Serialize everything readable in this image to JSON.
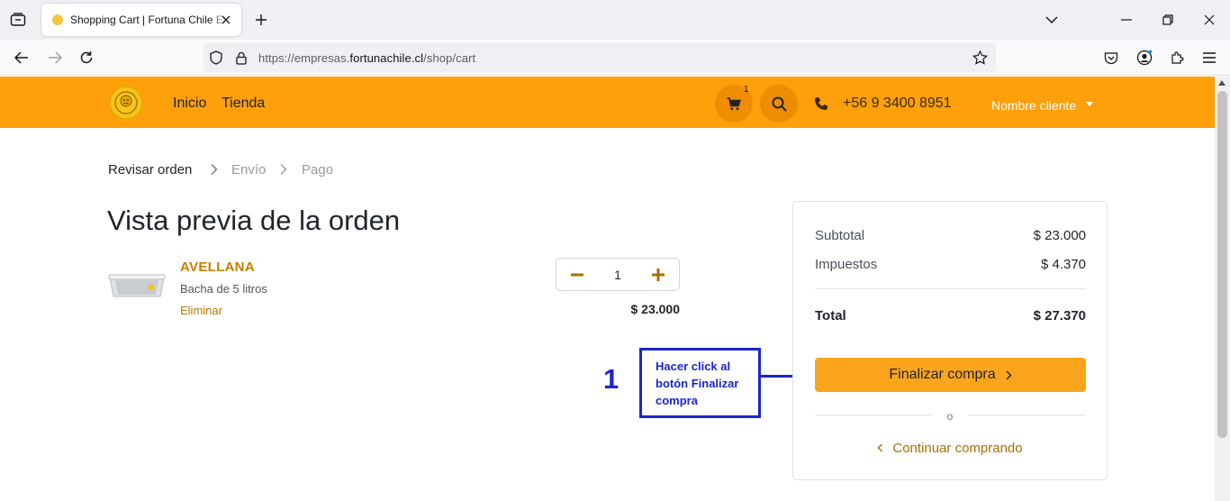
{
  "browser": {
    "tab_title": "Shopping Cart | Fortuna Chile E",
    "url_prefix": "https://empresas.",
    "url_domain": "fortunachile.cl",
    "url_path": "/shop/cart"
  },
  "header": {
    "nav": [
      "Inicio",
      "Tienda"
    ],
    "cart_count": "1",
    "phone": "+56 9 3400 8951",
    "client_name": "Nombre cliente",
    "colors": {
      "header_bg": "#ff9f0a",
      "accent_btn": "#fba51d"
    }
  },
  "breadcrumb": {
    "steps": [
      "Revisar orden",
      "Envío",
      "Pago"
    ],
    "active_step": 0
  },
  "page_title": "Vista previa de la orden",
  "cart_item": {
    "name": "AVELLANA",
    "description": "Bacha de 5 litros",
    "remove_label": "Eliminar",
    "quantity": "1",
    "price": "$ 23.000"
  },
  "summary": {
    "subtotal_label": "Subtotal",
    "subtotal_value": "$ 23.000",
    "tax_label": "Impuestos",
    "tax_value": "$ 4.370",
    "total_label": "Total",
    "total_value": "$ 27.370",
    "checkout_label": "Finalizar compra",
    "or_label": "o",
    "continue_label": "Continuar comprando"
  },
  "annotation": {
    "step_number": "1",
    "text": "Hacer click al botón Finalizar compra"
  }
}
